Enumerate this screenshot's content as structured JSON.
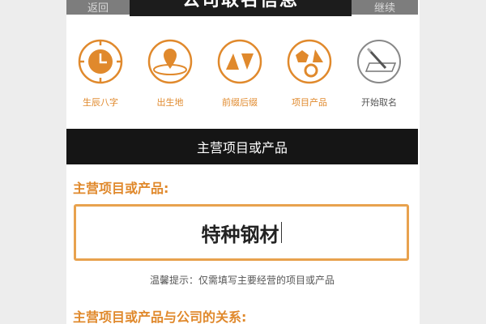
{
  "nav": {
    "back_label": "返回",
    "title": "公司取名信息",
    "next_label": "继续"
  },
  "steps": [
    {
      "label": "生辰八字",
      "icon": "clock-icon",
      "active": true
    },
    {
      "label": "出生地",
      "icon": "location-pin-icon",
      "active": true
    },
    {
      "label": "前缀后缀",
      "icon": "triangles-icon",
      "active": true
    },
    {
      "label": "项目产品",
      "icon": "shapes-icon",
      "active": true
    },
    {
      "label": "开始取名",
      "icon": "pencil-icon",
      "active": false
    }
  ],
  "section": {
    "title": "主营项目或产品"
  },
  "form": {
    "product_label": "主营项目或产品:",
    "product_value": "特种钢材",
    "hint": "温馨提示：仅需填写主要经营的项目或产品",
    "relation_label": "主营项目或产品与公司的关系:"
  },
  "colors": {
    "accent": "#e0892c",
    "header_bg": "#151515",
    "input_border": "#e8a24e"
  }
}
